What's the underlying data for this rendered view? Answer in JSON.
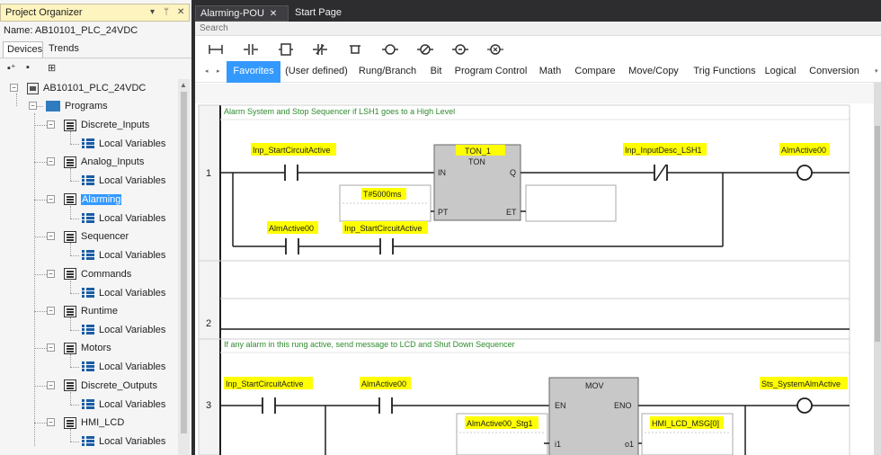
{
  "organizer": {
    "title": "Project Organizer",
    "pin_icon": "pin-icon",
    "close_icon": "close-icon",
    "name_label": "Name:",
    "name_value": "AB10101_PLC_24VDC",
    "tabs": [
      "Devices",
      "Trends"
    ],
    "tree": {
      "device": "AB10101_PLC_24VDC",
      "programs": "Programs",
      "items": [
        {
          "label": "Discrete_Inputs",
          "child": "Local Variables",
          "selected": false
        },
        {
          "label": "Analog_Inputs",
          "child": "Local Variables",
          "selected": false
        },
        {
          "label": "Alarming",
          "child": "Local Variables",
          "selected": true
        },
        {
          "label": "Sequencer",
          "child": "Local Variables",
          "selected": false
        },
        {
          "label": "Commands",
          "child": "Local Variables",
          "selected": false
        },
        {
          "label": "Runtime",
          "child": "Local Variables",
          "selected": false
        },
        {
          "label": "Motors",
          "child": "Local Variables",
          "selected": false
        },
        {
          "label": "Discrete_Outputs",
          "child": "Local Variables",
          "selected": false
        },
        {
          "label": "HMI_LCD",
          "child": "Local Variables",
          "selected": false
        }
      ]
    }
  },
  "doc_tabs": [
    {
      "label": "Alarming-POU",
      "active": true
    },
    {
      "label": "Start Page",
      "active": false
    }
  ],
  "search": {
    "placeholder": "Search"
  },
  "categories": [
    "Favorites",
    "(User defined)",
    "Rung/Branch",
    "Bit",
    "Program Control",
    "Math",
    "Compare",
    "Move/Copy",
    "Trig Functions",
    "Logical",
    "Conversion"
  ],
  "rungs": [
    {
      "number": "1",
      "comment": "Alarm System and Stop Sequencer if LSH1 goes to a High Level",
      "contact_1": "Inp_StartCircuitActive",
      "contact_2": "Inp_InputDesc_LSH1",
      "coil": "AlmActive00",
      "branch_contact_1": "AlmActive00",
      "branch_contact_2": "Inp_StartCircuitActive",
      "block": {
        "instance": "TON_1",
        "type": "TON",
        "pins": [
          "IN",
          "Q",
          "PT",
          "ET"
        ],
        "pt_value": "T#5000ms"
      }
    },
    {
      "number": "2"
    },
    {
      "number": "3",
      "comment": "If any alarm in this rung active, send message to LCD and Shut Down Sequencer",
      "contact_1": "Inp_StartCircuitActive",
      "contact_2": "AlmActive00",
      "coil": "Sts_SystemAlmActive",
      "block": {
        "type": "MOV",
        "pins": [
          "EN",
          "ENO",
          "i1",
          "o1"
        ],
        "in_value": "AlmActive00_Stg1",
        "out_value": "HMI_LCD_MSG[0]"
      }
    }
  ],
  "colors": {
    "highlight": "#ffff00",
    "selection": "#3399ff",
    "comment": "#2e8b2e"
  }
}
